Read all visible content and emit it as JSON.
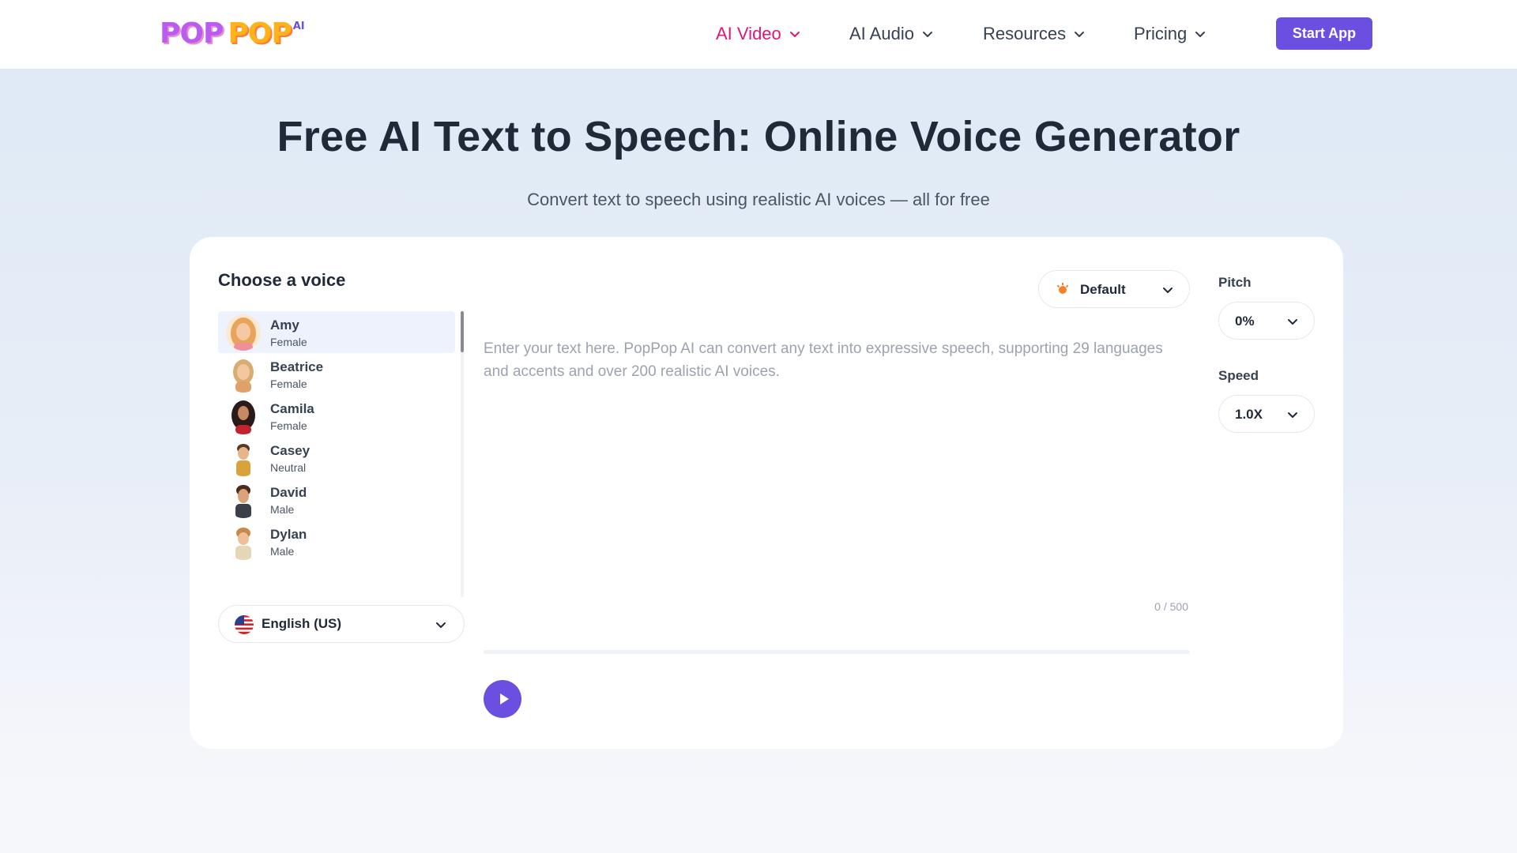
{
  "header": {
    "logo": {
      "part1": "POP",
      "part2": "POP",
      "suffix": "AI"
    },
    "nav": [
      {
        "label": "AI Video",
        "active": true
      },
      {
        "label": "AI Audio",
        "active": false
      },
      {
        "label": "Resources",
        "active": false
      },
      {
        "label": "Pricing",
        "active": false
      }
    ],
    "start_button": "Start App"
  },
  "hero": {
    "title": "Free AI Text to Speech: Online Voice Generator",
    "subtitle": "Convert text to speech using realistic AI voices — all for free"
  },
  "voices": {
    "title": "Choose a voice",
    "items": [
      {
        "name": "Amy",
        "gender": "Female",
        "selected": true
      },
      {
        "name": "Beatrice",
        "gender": "Female",
        "selected": false
      },
      {
        "name": "Camila",
        "gender": "Female",
        "selected": false
      },
      {
        "name": "Casey",
        "gender": "Neutral",
        "selected": false
      },
      {
        "name": "David",
        "gender": "Male",
        "selected": false
      },
      {
        "name": "Dylan",
        "gender": "Male",
        "selected": false
      }
    ],
    "language": "English (US)"
  },
  "editor": {
    "style": "Default",
    "placeholder": "Enter your text here. PopPop AI can convert any text into expressive speech, supporting 29 languages and accents and over 200 realistic AI voices.",
    "char_count": "0 / 500",
    "playback_progress": 0
  },
  "settings": {
    "pitch_label": "Pitch",
    "pitch_value": "0%",
    "speed_label": "Speed",
    "speed_value": "1.0X"
  },
  "colors": {
    "accent": "#6b4fe0",
    "nav_active": "#e0157a"
  }
}
